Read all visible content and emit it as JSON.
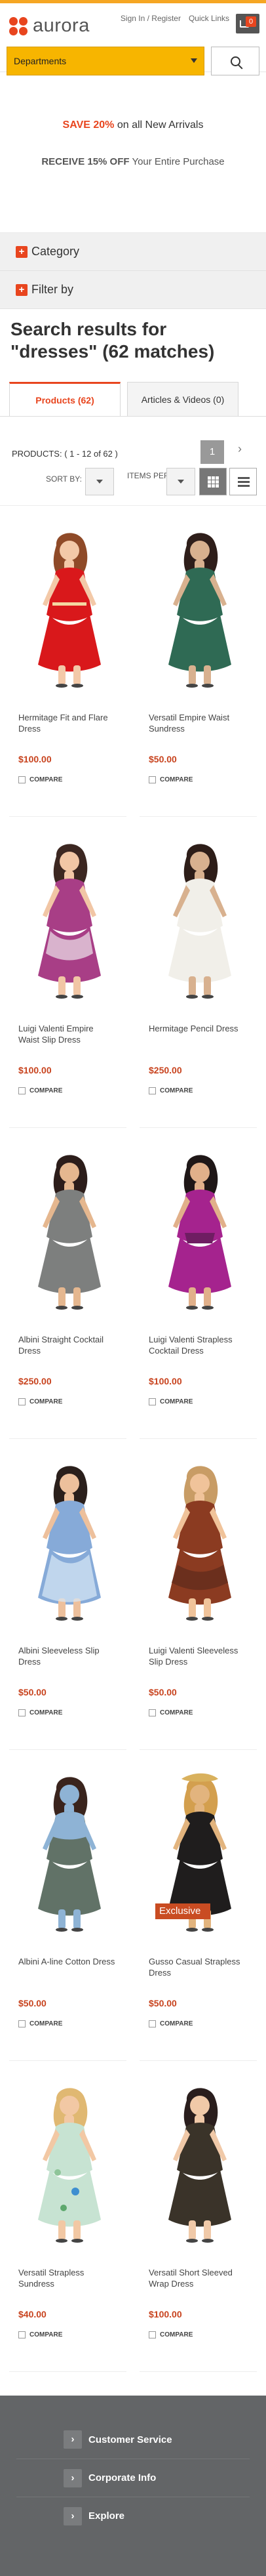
{
  "header": {
    "logo_text": "aurora",
    "sign_in_register": "Sign In / Register",
    "quick_links": "Quick Links",
    "cart_count": "0",
    "departments": "Departments"
  },
  "promo": {
    "line1_bold": "SAVE 20%",
    "line1_text": " on all New Arrivals",
    "line2_bold": "RECEIVE 15% OFF",
    "line2_text": " Your Entire Purchase"
  },
  "filters": {
    "category": "Category",
    "filter_by": "Filter by"
  },
  "results": {
    "title": "Search results for \"dresses\" (62 matches)",
    "tabs": [
      {
        "label": "Products (62)",
        "active": true
      },
      {
        "label": "Articles & Videos (0)",
        "active": false
      }
    ],
    "products_label": "PRODUCTS:",
    "products_range": "( 1 - 12 of 62 )",
    "current_page": "1",
    "sort_by": "SORT BY:",
    "items_per_page": "ITEMS PER PAGE:"
  },
  "products": [
    {
      "name": "Hermitage Fit and Flare Dress",
      "price": "$100.00",
      "compare": "COMPARE",
      "colors": {
        "main": "#d9181b",
        "accent": "#f3c9a8",
        "hair": "#8f4a28"
      }
    },
    {
      "name": "Versatil Empire Waist Sundress",
      "price": "$50.00",
      "compare": "COMPARE",
      "colors": {
        "main": "#2f6a54",
        "accent": "#d8b18f",
        "hair": "#2e1e1a"
      }
    },
    {
      "name": "Luigi Valenti Empire Waist Slip Dress",
      "price": "$100.00",
      "compare": "COMPARE",
      "colors": {
        "main": "#a83e86",
        "accent": "#f1c6a5",
        "hair": "#3c2721"
      }
    },
    {
      "name": "Hermitage Pencil Dress",
      "price": "$250.00",
      "compare": "COMPARE",
      "colors": {
        "main": "#f1efe9",
        "accent": "#d8b18f",
        "hair": "#2d1d18"
      }
    },
    {
      "name": "Albini Straight Cocktail Dress",
      "price": "$250.00",
      "compare": "COMPARE",
      "colors": {
        "main": "#7d7f7e",
        "accent": "#e5b78f",
        "hair": "#2c1d1a"
      }
    },
    {
      "name": "Luigi Valenti Strapless Cocktail Dress",
      "price": "$100.00",
      "compare": "COMPARE",
      "colors": {
        "main": "#a5238e",
        "accent": "#e1b08a",
        "hair": "#1f1717"
      }
    },
    {
      "name": "Albini Sleeveless Slip Dress",
      "price": "$50.00",
      "compare": "COMPARE",
      "colors": {
        "main": "#86aad8",
        "accent": "#edc09c",
        "hair": "#2a1f1b"
      }
    },
    {
      "name": "Luigi Valenti Sleeveless Slip Dress",
      "price": "$50.00",
      "compare": "COMPARE",
      "colors": {
        "main": "#8b3b21",
        "accent": "#f0c39a",
        "hair": "#c89c65"
      }
    },
    {
      "name": "Albini A-line Cotton Dress",
      "price": "$50.00",
      "compare": "COMPARE",
      "colors": {
        "main": "#617267",
        "accent": "#8eb3d5",
        "hair": "#3a241d"
      }
    },
    {
      "name": "Gusso Casual Strapless Dress",
      "price": "$50.00",
      "compare": "COMPARE",
      "exclusive": "Exclusive",
      "colors": {
        "main": "#1f1d1d",
        "accent": "#e2b47e",
        "hair": "#d39f4e"
      }
    },
    {
      "name": "Versatil Strapless Sundress",
      "price": "$40.00",
      "compare": "COMPARE",
      "colors": {
        "main": "#c7e3d2",
        "accent": "#f2c8a4",
        "hair": "#e0b872"
      }
    },
    {
      "name": "Versatil Short Sleeved Wrap Dress",
      "price": "$100.00",
      "compare": "COMPARE",
      "colors": {
        "main": "#3a3329",
        "accent": "#f0c9a8",
        "hair": "#2a1e1d"
      }
    }
  ],
  "footer": [
    {
      "label": "Customer Service"
    },
    {
      "label": "Corporate Info"
    },
    {
      "label": "Explore"
    }
  ],
  "icons": {
    "logo": "aurora-logo-icon",
    "cart": "shopping-cart-icon",
    "search": "search-icon",
    "plus": "plus-icon",
    "grid": "grid-view-icon",
    "list": "list-view-icon",
    "chevron": "chevron-right-icon"
  },
  "colors": {
    "accent": "#e8451e",
    "brand_yellow": "#f7b500",
    "footer": "#636567"
  }
}
